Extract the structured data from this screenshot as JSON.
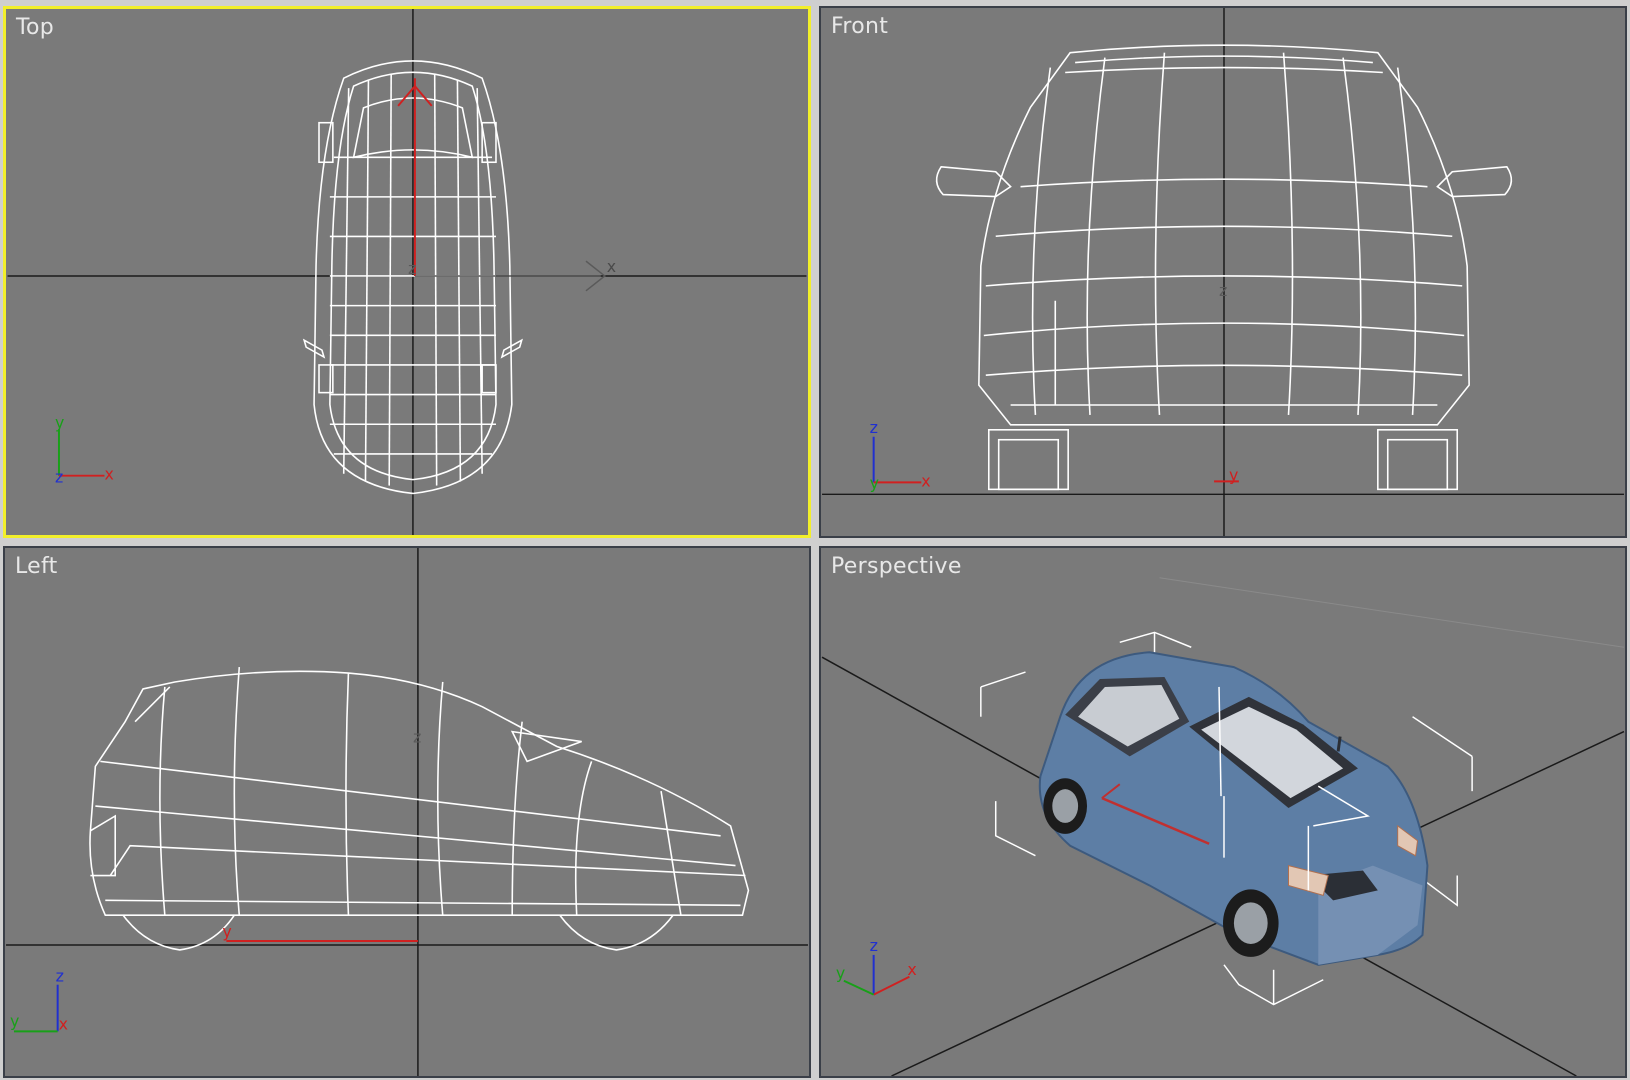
{
  "viewports": {
    "top": {
      "label": "Top",
      "active": true
    },
    "front": {
      "label": "Front",
      "active": false
    },
    "left": {
      "label": "Left",
      "active": false
    },
    "perspective": {
      "label": "Perspective",
      "active": false
    }
  },
  "axis_labels": {
    "x": "x",
    "y": "y",
    "z": "z"
  },
  "colors": {
    "viewport_bg": "#7a7a7a",
    "active_border": "#f2ef2a",
    "wireframe": "#ffffff",
    "x_axis": "#d02020",
    "y_axis": "#18a018",
    "z_axis": "#2030d0",
    "car_body": "#5d7ea5"
  }
}
